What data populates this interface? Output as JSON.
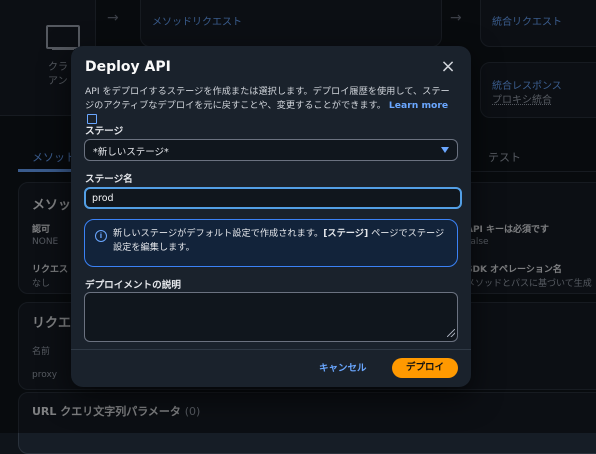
{
  "background": {
    "flow": {
      "method_request": "メソッドリクエスト",
      "integration_request": "統合リクエスト",
      "integration_response": "統合レスポンス",
      "proxy_integration": "プロキシ統合",
      "client_label_1": "クラ",
      "client_label_2": "アン",
      "arrow": "→"
    },
    "tabs": {
      "method": "メソット",
      "test": "テスト"
    },
    "section_title": "メソッ",
    "auth_label": "認可",
    "auth_value": "NONE",
    "request_label": "リクエス",
    "request_value": "なし",
    "api_key_label": "API キーは必須です",
    "api_key_value": "False",
    "operation_label": "SDK オペレーション名",
    "operation_value": "メソッドとパスに基づいて生成",
    "request_paths_title": "リクエス",
    "name_header": "名前",
    "proxy_value": "proxy",
    "url_query_title": "URL クエリ文字列パラメータ",
    "url_query_count": "(0)"
  },
  "modal": {
    "title": "Deploy API",
    "close_icon": "×",
    "description": "API をデプロイするステージを作成または選択します。デプロイ履歴を使用して、ステージのアクティブなデプロイを元に戻すことや、変更することができます。",
    "learn_more": "Learn more",
    "stage_label": "ステージ",
    "stage_value": "*新しいステージ*",
    "stage_name_label": "ステージ名",
    "stage_name_value": "prod",
    "info_text_prefix": "新しいステージがデフォルト設定で作成されます。",
    "info_text_bold": "[ステージ]",
    "info_text_suffix": " ページでステージ設定を編集します。",
    "info_icon": "i",
    "deployment_desc_label": "デプロイメントの説明",
    "deployment_desc_value": "",
    "cancel_label": "キャンセル",
    "deploy_label": "デプロイ"
  },
  "colors": {
    "accent": "#ff9900",
    "link": "#6aa7ff",
    "focus": "#539fe5",
    "modal_bg": "#1a222c",
    "page_bg": "#0f141a"
  }
}
